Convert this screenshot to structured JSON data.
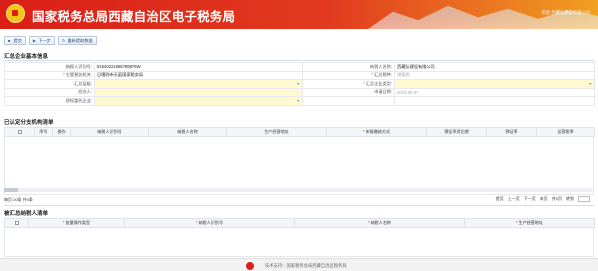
{
  "header": {
    "title": "国家税务总局西藏自治区电子税务局",
    "user": "欢迎 西藏弘建设有限公司",
    "brand_color": "#d91f17"
  },
  "toolbar": {
    "buttons": [
      {
        "label": "提交",
        "icon": "save-icon"
      },
      {
        "label": "下一步",
        "icon": "next-icon"
      },
      {
        "label": "重新提取数据",
        "icon": "refresh-icon"
      }
    ]
  },
  "basic": {
    "section_title": "汇总企业基本信息",
    "rows": [
      {
        "l1": "纳税人识别号:",
        "v1": "91540221565789876W",
        "l2": "纳税人名称:",
        "v2": "西藏弘建设有限公司"
      },
      {
        "l1": "主管税务机关:",
        "v1": "日喀则市天庭国家税务局",
        "l2": "汇总税种:",
        "v2": "增值税"
      },
      {
        "l1": "汇总层级:",
        "v1": "",
        "l2": "汇总企业类型:",
        "v2": ""
      },
      {
        "l1": "经办人:",
        "v1": "",
        "l2": "申请日期:",
        "v2": "2018-06-07"
      },
      {
        "l1": "授权委托企业:",
        "v1": "",
        "l2": "",
        "v2": ""
      }
    ]
  },
  "branches": {
    "section_title": "已认定分支机构清单",
    "columns": [
      "序号",
      "操作",
      "纳税人识别号",
      "纳税人名称",
      "生产经营地址",
      "申报缴纳方式",
      "预征率资后期",
      "预征率",
      "运营税率"
    ],
    "pagination": {
      "left": "每页 20条 共0条",
      "first": "首页",
      "prev": "上一页",
      "next": "下一页",
      "last": "末页",
      "total_pages": "共0页",
      "goto": "转到"
    }
  },
  "pending": {
    "section_title": "被汇总纳税人清单",
    "columns": [
      "批量操作类型",
      "纳税人识别号",
      "纳税人名称",
      "生产经营地址"
    ]
  },
  "footer": {
    "text": "技术支持：国家税务总局西藏自治区税务局"
  }
}
